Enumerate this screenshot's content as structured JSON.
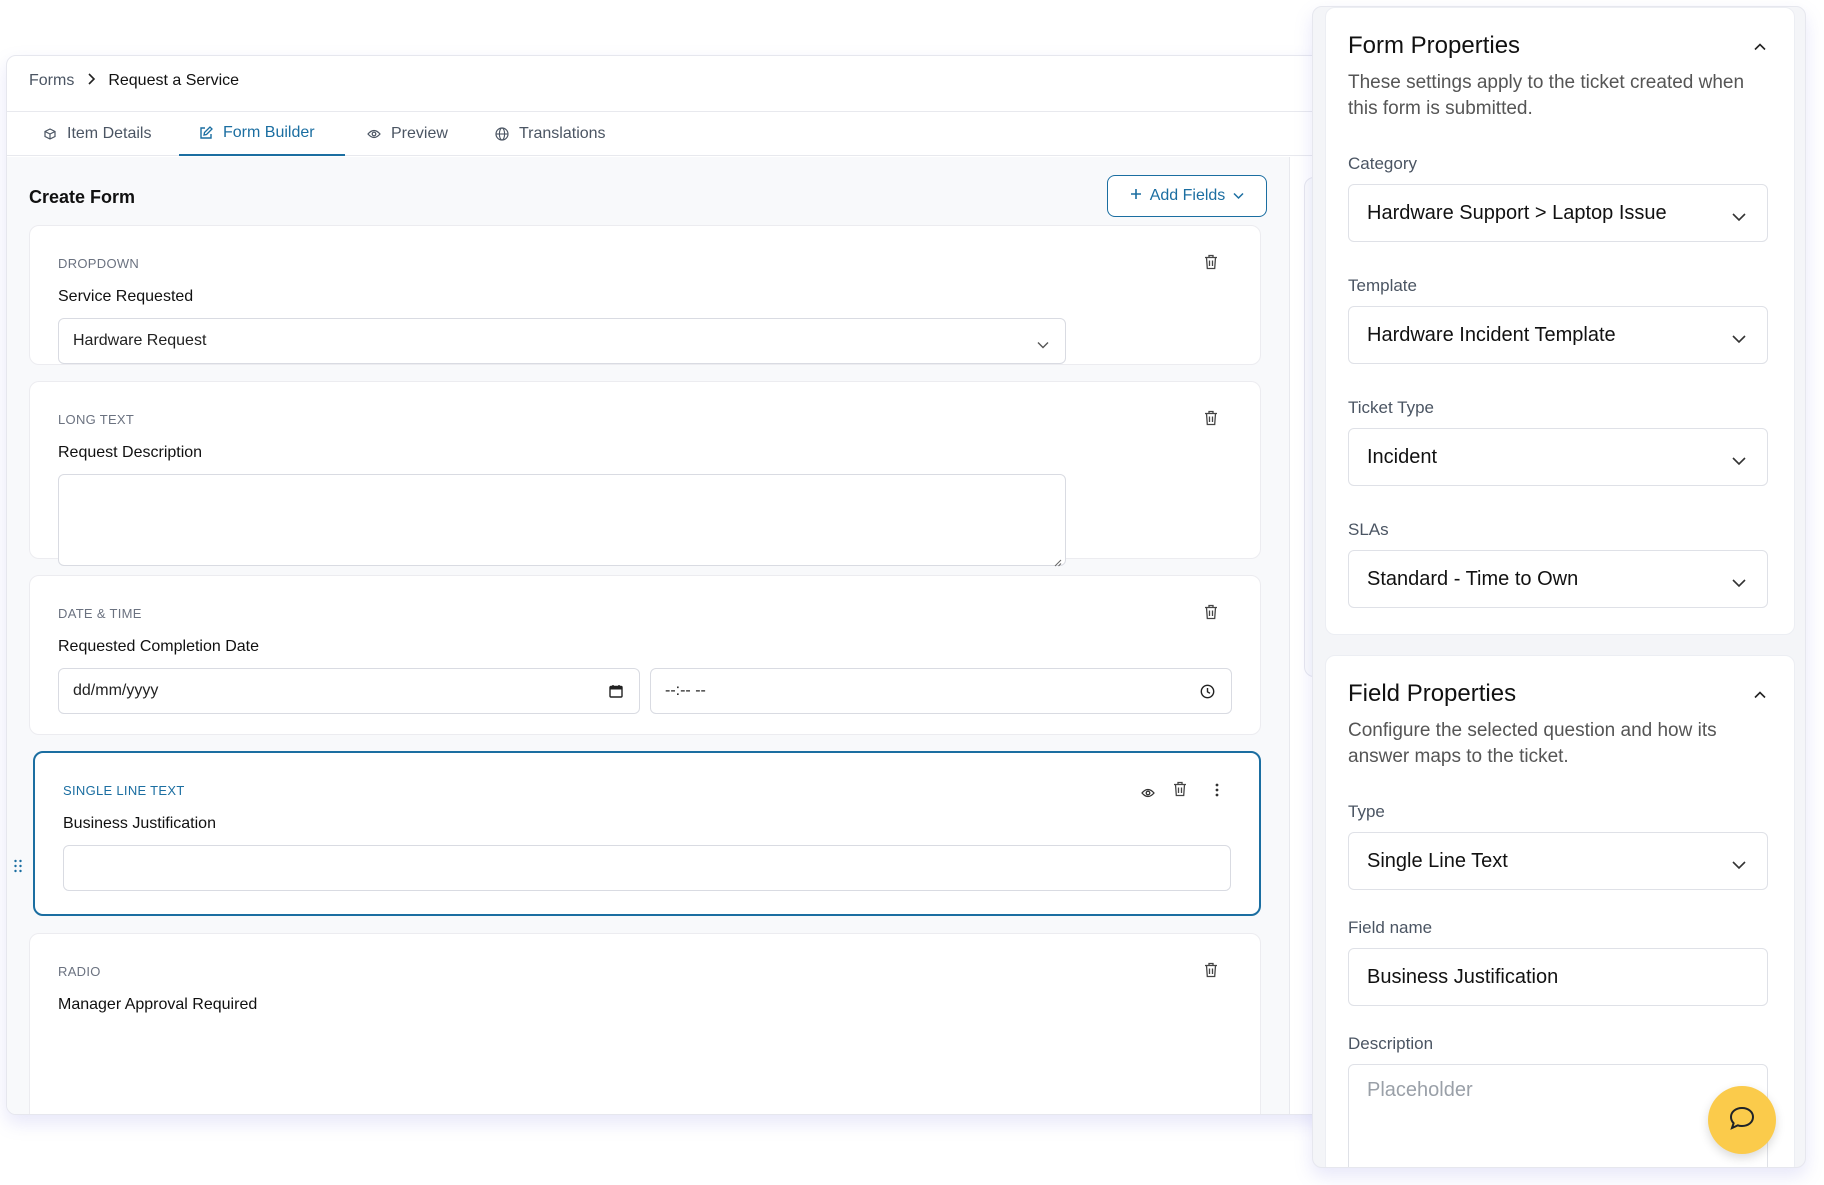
{
  "breadcrumb": {
    "root": "Forms",
    "current": "Request a Service"
  },
  "tabs": [
    {
      "label": "Item Details"
    },
    {
      "label": "Form Builder"
    },
    {
      "label": "Preview"
    },
    {
      "label": "Translations"
    }
  ],
  "builder": {
    "title": "Create Form",
    "add_fields_label": "Add Fields",
    "fields": [
      {
        "type": "DROPDOWN",
        "label": "Service Requested",
        "value": "Hardware Request"
      },
      {
        "type": "LONG TEXT",
        "label": "Request Description",
        "value": ""
      },
      {
        "type": "DATE & TIME",
        "label": "Requested Completion Date",
        "date_placeholder": "dd/mm/yyyy",
        "time_placeholder": "--:-- --"
      },
      {
        "type": "SINGLE LINE TEXT",
        "label": "Business Justification",
        "value": ""
      },
      {
        "type": "RADIO",
        "label": "Manager Approval Required"
      }
    ]
  },
  "form_properties": {
    "title": "Form Properties",
    "description": "These settings apply to the ticket created when this form is submitted.",
    "category_label": "Category",
    "category_value": "Hardware Support > Laptop Issue",
    "template_label": "Template",
    "template_value": "Hardware Incident Template",
    "ticket_type_label": "Ticket Type",
    "ticket_type_value": "Incident",
    "slas_label": "SLAs",
    "slas_value": "Standard - Time to Own"
  },
  "field_properties": {
    "title": "Field Properties",
    "description": "Configure the selected question and how its answer maps to the ticket.",
    "type_label": "Type",
    "type_value": "Single Line Text",
    "field_name_label": "Field name",
    "field_name_value": "Business Justification",
    "description_label": "Description",
    "description_placeholder": "Placeholder"
  },
  "colors": {
    "accent": "#1b6ea1",
    "chat_fab": "#fbcb4b"
  }
}
